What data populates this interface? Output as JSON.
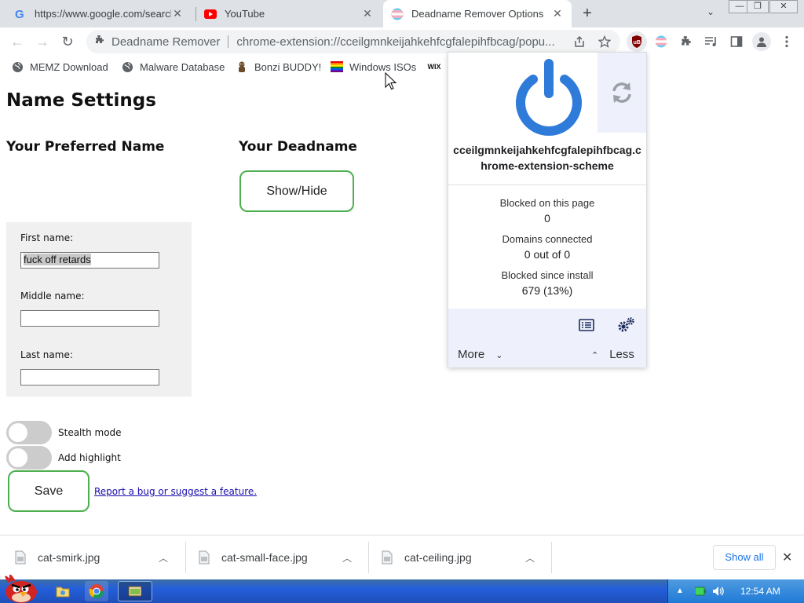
{
  "tabs": [
    {
      "title": "https://www.google.com/search",
      "close": "✕"
    },
    {
      "title": "YouTube",
      "close": "✕"
    },
    {
      "title": "Deadname Remover Options",
      "close": "✕"
    }
  ],
  "new_tab_glyph": "+",
  "tab_search_glyph": "⌄",
  "window_controls": {
    "minimize": "—",
    "restore": "❐",
    "close": "✕"
  },
  "toolbar": {
    "back": "←",
    "forward": "→",
    "reload": "↻",
    "extension_name": "Deadname Remover",
    "url": "chrome-extension://cceilgmnkeijahkehfcgfalepihfbcag/popu..."
  },
  "bookmarks": [
    {
      "label": "MEMZ Download",
      "icon": "globe-icon"
    },
    {
      "label": "Malware Database",
      "icon": "globe-icon"
    },
    {
      "label": "Bonzi BUDDY!",
      "icon": "bonzi-icon"
    },
    {
      "label": "Windows ISOs",
      "icon": "rainbow-flag-icon"
    },
    {
      "label": "",
      "icon": "wix-icon"
    }
  ],
  "page": {
    "title": "Name Settings",
    "preferred_heading": "Your Preferred Name",
    "deadname_heading": "Your Deadname",
    "show_hide_label": "Show/Hide",
    "first_label": "First name:",
    "first_value": "fuck off retards",
    "middle_label": "Middle name:",
    "middle_value": "",
    "last_label": "Last name:",
    "last_value": "",
    "stealth_label": "Stealth mode",
    "highlight_label": "Add highlight",
    "save_label": "Save",
    "report_link": "Report a bug or suggest a feature."
  },
  "ublock": {
    "hostname": "cceilgmnkeijahkehfcgfalepihfbcag.chrome-extension-scheme",
    "blocked_page_label": "Blocked on this page",
    "blocked_page_value": "0",
    "domains_label": "Domains connected",
    "domains_value": "0 out of 0",
    "blocked_install_label": "Blocked since install",
    "blocked_install_value": "679 (13%)",
    "more_label": "More",
    "less_label": "Less",
    "power_color": "#2f7bd9"
  },
  "downloads": [
    {
      "name": "cat-smirk.jpg"
    },
    {
      "name": "cat-small-face.jpg"
    },
    {
      "name": "cat-ceiling.jpg"
    }
  ],
  "download_caret": "︿",
  "show_all_label": "Show all",
  "download_close": "✕",
  "clock": "12:54 AM"
}
